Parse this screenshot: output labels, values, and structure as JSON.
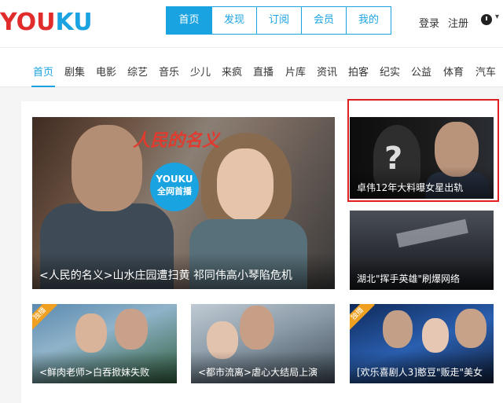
{
  "brand": {
    "logo_y": "YOU",
    "logo_k": "KU"
  },
  "topnav": {
    "items": [
      "首页",
      "发现",
      "订阅",
      "会员",
      "我的"
    ]
  },
  "account": {
    "login": "登录",
    "register": "注册"
  },
  "categories": [
    "首页",
    "剧集",
    "电影",
    "综艺",
    "音乐",
    "少儿",
    "来疯",
    "直播",
    "片库",
    "资讯",
    "拍客",
    "纪实",
    "公益",
    "体育",
    "汽车"
  ],
  "hero": {
    "caption": "<人民的名义>山水庄园遭扫黄 祁同伟高小琴陷危机",
    "art_title": "人民的名义",
    "badge_line1": "YOUKU",
    "badge_line2": "全网首播"
  },
  "side": [
    {
      "caption": "卓伟12年大料曝女星出轨"
    },
    {
      "caption": "湖北\"挥手英雄\"刷爆网络"
    }
  ],
  "bottom": [
    {
      "caption": "<鲜肉老师>白吞掀妹失败",
      "ribbon": "独播"
    },
    {
      "caption": "<都市流离>虐心大结局上演"
    },
    {
      "caption": "[欢乐喜剧人3]憨豆\"贩走\"美女",
      "ribbon": "独播"
    }
  ],
  "colors": {
    "accent": "#1aa3e1",
    "logo_red": "#e12c2c",
    "highlight_frame": "#e02020"
  }
}
